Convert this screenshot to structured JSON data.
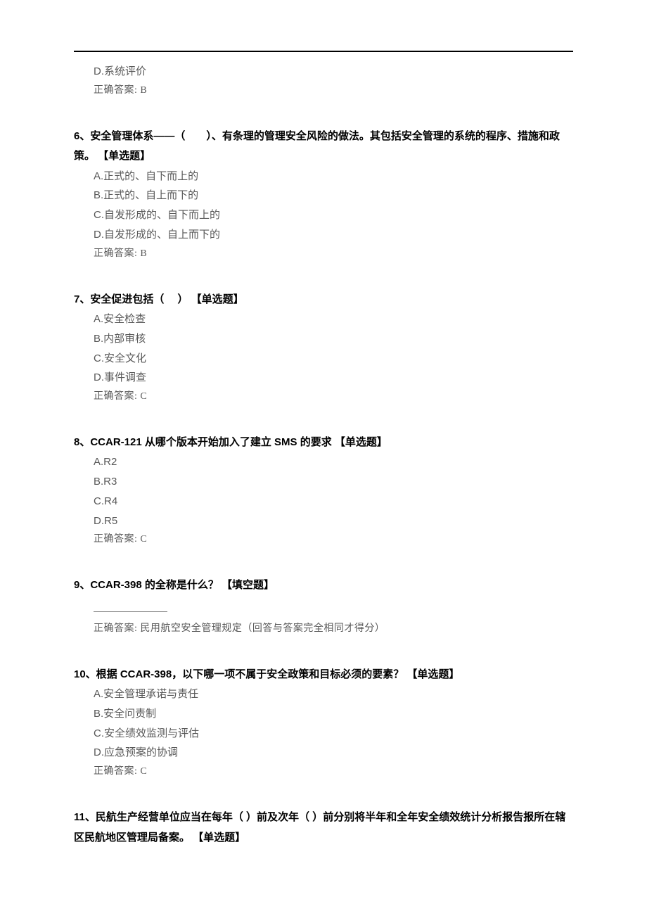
{
  "answer_prefix": "正确答案:",
  "q5": {
    "option_d": "D.系统评价",
    "answer": "B"
  },
  "q6": {
    "stem": "6、安全管理体系——（　　）、有条理的管理安全风险的做法。其包括安全管理的系统的程序、措施和政策。  【单选题】",
    "options": [
      "A.正式的、自下而上的",
      "B.正式的、自上而下的",
      "C.自发形成的、自下而上的",
      "D.自发形成的、自上而下的"
    ],
    "answer": "B"
  },
  "q7": {
    "stem": "7、安全促进包括（　 ）  【单选题】",
    "options": [
      "A.安全检查",
      "B.内部审核",
      "C.安全文化",
      "D.事件调查"
    ],
    "answer": "C"
  },
  "q8": {
    "stem": "8、CCAR-121 从哪个版本开始加入了建立 SMS 的要求  【单选题】",
    "options": [
      "A.R2",
      "B.R3",
      "C.R4",
      "D.R5"
    ],
    "answer": "C"
  },
  "q9": {
    "stem": "9、CCAR-398 的全称是什么？  【填空题】",
    "answer": "民用航空安全管理规定（回答与答案完全相同才得分）"
  },
  "q10": {
    "stem": "10、根据 CCAR-398，以下哪一项不属于安全政策和目标必须的要素？  【单选题】",
    "options": [
      "A.安全管理承诺与责任",
      "B.安全问责制",
      "C.安全绩效监测与评估",
      "D.应急预案的协调"
    ],
    "answer": "C"
  },
  "q11": {
    "stem": "11、民航生产经营单位应当在每年（  ）前及次年（  ）前分别将半年和全年安全绩效统计分析报告报所在辖区民航地区管理局备案。  【单选题】"
  }
}
